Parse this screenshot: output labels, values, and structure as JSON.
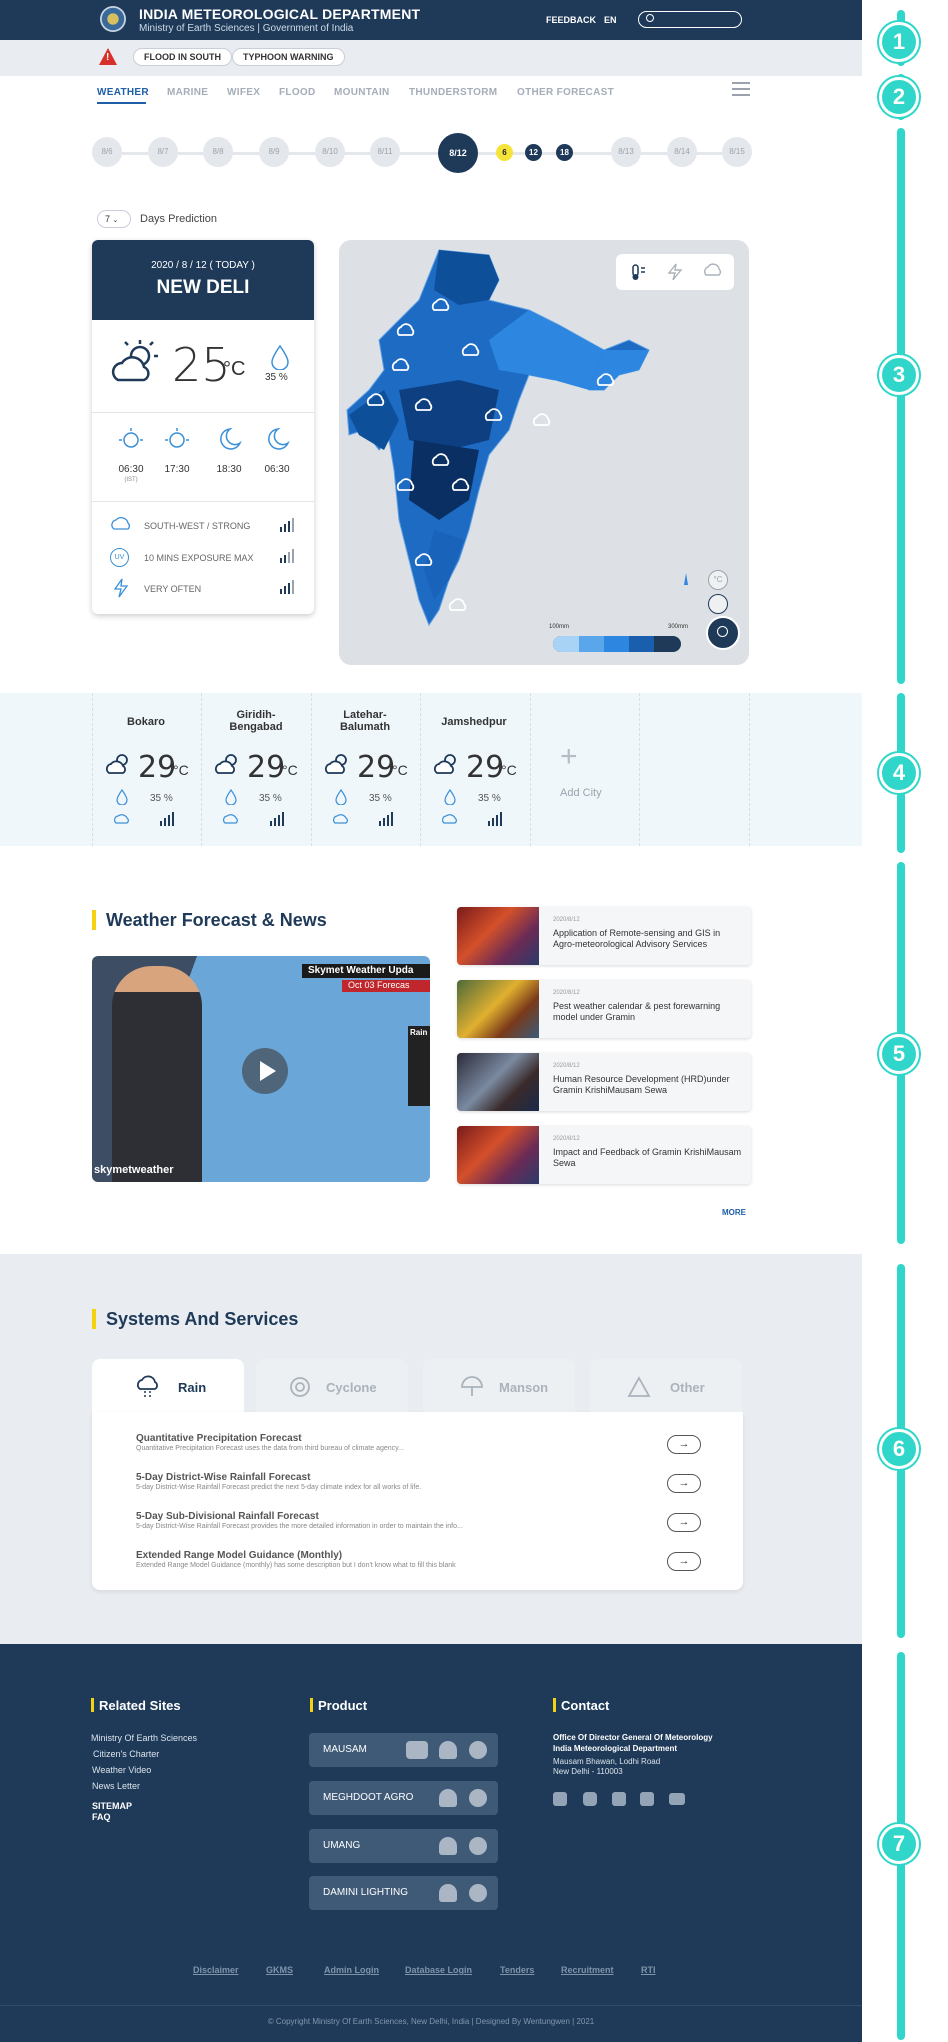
{
  "header": {
    "title": "INDIA METEOROLOGICAL DEPARTMENT",
    "subtitle": "Ministry of Earth Sciences | Government of India",
    "feedback": "FEEDBACK",
    "lang": "EN"
  },
  "alerts": [
    "FLOOD IN SOUTH",
    "TYPHOON WARNING"
  ],
  "tabs": [
    "WEATHER",
    "MARINE",
    "WIFEX",
    "FLOOD",
    "MOUNTAIN",
    "THUNDERSTORM",
    "OTHER FORECAST"
  ],
  "timeline": {
    "days": [
      "8/6",
      "8/7",
      "8/8",
      "8/9",
      "8/10",
      "8/11",
      "8/12",
      "8/13",
      "8/14",
      "8/15"
    ],
    "sub": [
      "6",
      "12",
      "18"
    ]
  },
  "prediction": {
    "value": "7",
    "label": "Days Prediction"
  },
  "today": {
    "date": "2020 / 8 / 12  ( TODAY )",
    "city": "NEW DELI",
    "temp": "25",
    "unit": "°C",
    "humidity": "35 %",
    "times": [
      "06:30",
      "17:30",
      "18:30",
      "06:30"
    ],
    "ist": "(IST)",
    "wind": "SOUTH-WEST / STRONG",
    "uv": "10 MINS EXPOSURE MAX",
    "lightning": "VERY OFTEN",
    "uv_badge": "UV"
  },
  "map": {
    "legend_min": "100mm",
    "legend_max": "300mm"
  },
  "cities": [
    {
      "name": "Bokaro",
      "temp": "29",
      "pct": "35 %"
    },
    {
      "name": "Giridih-\nBengabad",
      "temp": "29",
      "pct": "35 %"
    },
    {
      "name": "Latehar-\nBalumath",
      "temp": "29",
      "pct": "35 %"
    },
    {
      "name": "Jamshedpur",
      "temp": "29",
      "pct": "35 %"
    }
  ],
  "unit": "°C",
  "add_city": "Add City",
  "news": {
    "title": "Weather Forecast & News",
    "video_banner": "Skymet Weather Upda",
    "video_date": "Oct 03 Forecas",
    "video_logo": "skymetweather",
    "video_legend": "Rain",
    "more": "MORE",
    "items": [
      {
        "date": "2020/8/12",
        "text": "Application of Remote-sensing and GIS in Agro-meteorological Advisory Services"
      },
      {
        "date": "2020/8/12",
        "text": "Pest weather calendar & pest forewarning model under Gramin"
      },
      {
        "date": "2020/8/12",
        "text": "Human Resource Development (HRD)under Gramin KrishiMausam Sewa"
      },
      {
        "date": "2020/8/12",
        "text": "Impact and Feedback of Gramin KrishiMausam Sewa"
      }
    ]
  },
  "services": {
    "title": "Systems And Services",
    "tabs": [
      "Rain",
      "Cyclone",
      "Manson",
      "Other"
    ],
    "items": [
      {
        "t": "Quantitative Precipitation Forecast",
        "d": "Quantitative Precipitation Forecast uses the data from third bureau of climate agency..."
      },
      {
        "t": "5-Day District-Wise Rainfall Forecast",
        "d": "5-day District-Wise Rainfall Forecast predict the next 5-day climate index for all works of life."
      },
      {
        "t": "5-Day Sub-Divisional Rainfall Forecast",
        "d": "5-day District-Wise Rainfall Forecast provides the more detailed information in order to maintain the info..."
      },
      {
        "t": "Extended Range Model Guidance (Monthly)",
        "d": "Extended Range Model Guidance (monthly) has some description but I don't know what to fill this blank"
      }
    ]
  },
  "footer": {
    "related_title": "Related Sites",
    "related": [
      "Ministry Of Earth Sciences",
      "Citizen's Charter",
      "Weather Video",
      "News Letter"
    ],
    "sitemap": "SITEMAP",
    "faq": "FAQ",
    "product_title": "Product",
    "products": [
      "MAUSAM",
      "MEGHDOOT AGRO",
      "UMANG",
      "DAMINI LIGHTING"
    ],
    "contact_title": "Contact",
    "contact_org1": "Office Of Director General Of Meteorology",
    "contact_org2": "India Meteorological Department",
    "contact_addr1": "Mausam Bhawan, Lodhi Road",
    "contact_addr2": "New Delhi - 110003",
    "links": [
      "Disclaimer",
      "GKMS",
      "Admin Login",
      "Database Login",
      "Tenders",
      "Recruitment",
      "RTI"
    ],
    "copyright": "© Copyright Ministry Of Earth Sciences, New Delhi, India  |  Designed By Wentungwen | 2021"
  },
  "annotations": [
    "1",
    "2",
    "3",
    "4",
    "5",
    "6",
    "7"
  ],
  "colors": {
    "navy": "#1e3a58",
    "accent": "#1e5fa8",
    "yellow": "#f5d20f",
    "teal": "#2fd6c9"
  }
}
